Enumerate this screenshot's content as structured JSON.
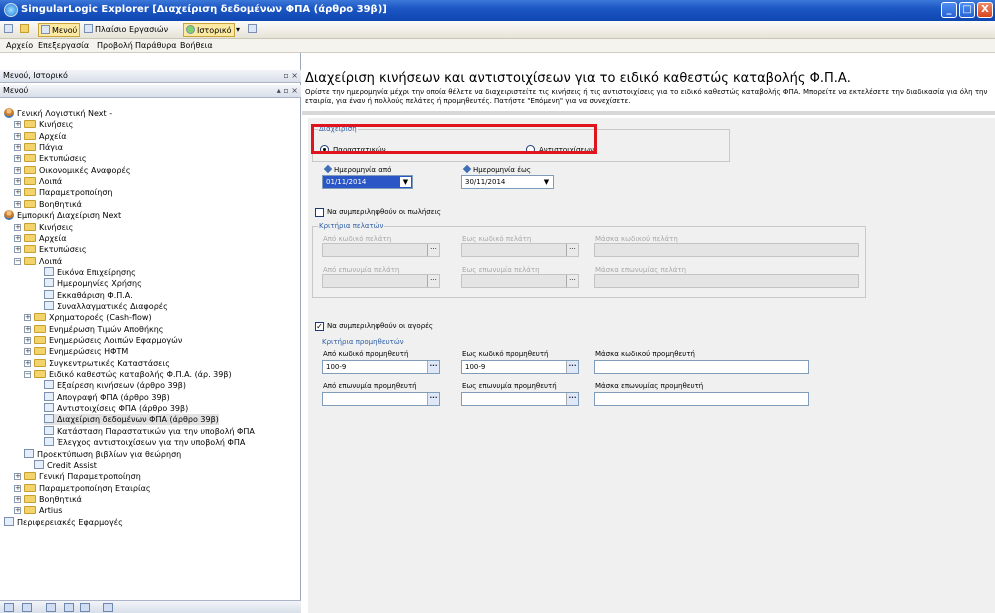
{
  "window": {
    "title": "SingularLogic Explorer [Διαχείριση δεδομένων ΦΠΑ (άρθρο 39β)]",
    "min": "_",
    "max": "□",
    "close": "X"
  },
  "toolbar": {
    "menu_label": "Μενού",
    "frame_label": "Πλαίσιο Εργασιών",
    "history_label": "Ιστορικό"
  },
  "menubar": [
    "Αρχείο",
    "Επεξεργασία",
    "Προβολή",
    "Παράθυρα",
    "Βοήθεια"
  ],
  "left": {
    "header1": "Μενού, Ιστορικό",
    "header2": "Μενού",
    "tree": [
      {
        "label": "Γενική Λογιστική Next -",
        "type": "person"
      },
      {
        "label": "Κινήσεις",
        "type": "folder",
        "plus": "+"
      },
      {
        "label": "Αρχεία",
        "type": "folder",
        "plus": "+"
      },
      {
        "label": "Πάγια",
        "type": "folder",
        "plus": "+"
      },
      {
        "label": "Εκτυπώσεις",
        "type": "folder",
        "plus": "+"
      },
      {
        "label": "Οικονομικές Αναφορές",
        "type": "folder",
        "plus": "+"
      },
      {
        "label": "Λοιπά",
        "type": "folder",
        "plus": "+"
      },
      {
        "label": "Παραμετροποίηση",
        "type": "folder",
        "plus": "+"
      },
      {
        "label": "Βοηθητικά",
        "type": "folder",
        "plus": "+"
      },
      {
        "label": "Εμπορική Διαχείριση Next",
        "type": "person"
      },
      {
        "label": "Κινήσεις",
        "type": "folder",
        "plus": "+"
      },
      {
        "label": "Αρχεία",
        "type": "folder",
        "plus": "+"
      },
      {
        "label": "Εκτυπώσεις",
        "type": "folder",
        "plus": "+"
      },
      {
        "label": "Λοιπά",
        "type": "folder",
        "plus": "−"
      },
      {
        "label": "Εικόνα Επιχείρησης",
        "type": "leaf"
      },
      {
        "label": "Ημερομηνίες Χρήσης",
        "type": "leaf"
      },
      {
        "label": "Εκκαθάριση Φ.Π.Α.",
        "type": "leaf"
      },
      {
        "label": "Συναλλαγματικές Διαφορές",
        "type": "leaf"
      },
      {
        "label": "Χρηματοροές (Cash-flow)",
        "type": "folder",
        "plus": "+"
      },
      {
        "label": "Ενημέρωση Τιμών Αποθήκης",
        "type": "folder",
        "plus": "+"
      },
      {
        "label": "Ενημερώσεις Λοιπών Εφαρμογών",
        "type": "folder",
        "plus": "+"
      },
      {
        "label": "Ενημερώσεις ΗΦΤΜ",
        "type": "folder",
        "plus": "+"
      },
      {
        "label": "Συγκεντρωτικές Καταστάσεις",
        "type": "folder",
        "plus": "+"
      },
      {
        "label": "Ειδικό καθεστώς καταβολής Φ.Π.Α. (άρ. 39β)",
        "type": "folder",
        "plus": "−"
      },
      {
        "label": "Εξαίρεση κινήσεων (άρθρο 39β)",
        "type": "leaf"
      },
      {
        "label": "Απογραφή ΦΠΑ (άρθρο 39β)",
        "type": "leaf"
      },
      {
        "label": "Αντιστοιχίσεις ΦΠΑ (άρθρο 39β)",
        "type": "leaf"
      },
      {
        "label": "Διαχείριση δεδομένων ΦΠΑ (άρθρο 39β)",
        "type": "leaf",
        "selected": true
      },
      {
        "label": "Κατάσταση Παραστατικών για την υποβολή ΦΠΑ",
        "type": "leaf"
      },
      {
        "label": "Έλεγχος αντιστοιχίσεων για την υποβολή ΦΠΑ",
        "type": "leaf"
      },
      {
        "label": "Προεκτύπωση βιβλίων για θεώρηση",
        "type": "leaf"
      },
      {
        "label": "Credit Assist",
        "type": "leaf"
      },
      {
        "label": "Γενική Παραμετροποίηση",
        "type": "folder",
        "plus": "+"
      },
      {
        "label": "Παραμετροποίηση Εταιρίας",
        "type": "folder",
        "plus": "+"
      },
      {
        "label": "Βοηθητικά",
        "type": "folder",
        "plus": "+"
      },
      {
        "label": "Artius",
        "type": "folder",
        "plus": "+"
      },
      {
        "label": "Περιφερειακές Εφαρμογές",
        "type": "leaf"
      }
    ]
  },
  "main": {
    "title": "Διαχείριση κινήσεων και αντιστοιχίσεων για το ειδικό καθεστώς καταβολής Φ.Π.Α.",
    "description": "Ορίστε την ημερομηνία μέχρι την οποία θέλετε να διαχειριστείτε τις κινήσεις ή τις αντιστοιχίσεις για το ειδικό καθεστώς καταβολής ΦΠΑ. Μπορείτε να εκτελέσετε την διαδικασία για όλη την εταιρία, για έναν ή πολλούς πελάτες ή προμηθευτές. Πατήστε \"Επόμενη\" για να συνεχίσετε.",
    "management": {
      "legend": "Διαχείριση",
      "option1": "Παραστατικών",
      "option2": "Αντιστοιχίσεων"
    },
    "date_from": {
      "label": "Ημερομηνία από",
      "value": "01/11/2014"
    },
    "date_to": {
      "label": "Ημερομηνία έως",
      "value": "30/11/2014"
    },
    "sales_check": "Να συμπεριληφθούν οι πωλήσεις",
    "customers": {
      "title": "Κριτήρια πελατών",
      "from_code": "Από κωδικό πελάτη",
      "to_code": "Εως κωδικό πελάτη",
      "code_mask": "Μάσκα κωδικού πελάτη",
      "from_name": "Από επωνυμία πελάτη",
      "to_name": "Εως επωνυμία πελάτη",
      "name_mask": "Μάσκα επωνυμίας πελάτη"
    },
    "purchases_check": "Να συμπεριληφθούν οι αγορές",
    "suppliers": {
      "title": "Κριτήρια προμηθευτών",
      "from_code": "Από κωδικό προμηθευτή",
      "from_code_value": "100-9",
      "to_code": "Εως κωδικό προμηθευτή",
      "to_code_value": "100-9",
      "code_mask": "Μάσκα κωδικού προμηθευτή",
      "from_name": "Από επωνυμία προμηθευτή",
      "to_name": "Εως επωνυμία προμηθευτή",
      "name_mask": "Μάσκα επωνυμίας προμηθευτή"
    }
  },
  "colors": {
    "highlight_box": "#e0141e",
    "accent_blue": "#2e5fa6"
  }
}
